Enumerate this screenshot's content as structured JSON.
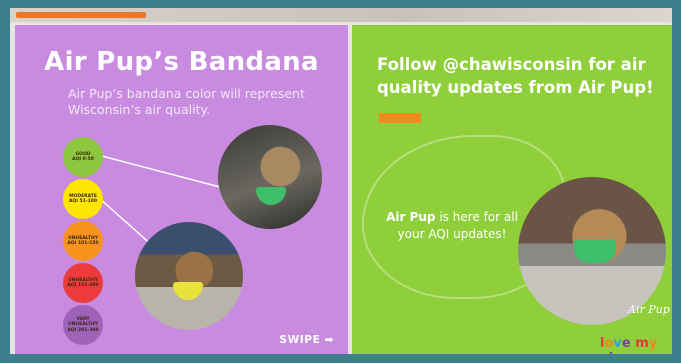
{
  "left": {
    "title": "Air Pup’s Bandana",
    "subtitle": "Air Pup’s bandana color will represent Wisconsin’s air quality.",
    "swipe": "SWIPE ➡",
    "levels": [
      {
        "line1": "GOOD",
        "line2": "AQI 0-50",
        "color": "#8dc63f"
      },
      {
        "line1": "MODERATE",
        "line2": "AQI 51-100",
        "color": "#ffe600"
      },
      {
        "line1": "UNHEALTHY",
        "line2": "AQI 101-150",
        "color": "#f7931e"
      },
      {
        "line1": "UNHEALTHY",
        "line2": "AQI 151-200",
        "color": "#ed3a3a"
      },
      {
        "line1": "VERY UNHEALTHY",
        "line2": "AQI 201-300",
        "color": "#9e62b8"
      }
    ]
  },
  "right": {
    "title": "Follow @chawisconsin for air quality updates from Air Pup!",
    "text_bold": "Air Pup",
    "text_rest": " is here for all your AQI updates!",
    "signature": "Air Pup",
    "logo": [
      "l",
      "o",
      "v",
      "e",
      " ",
      "m",
      "y",
      " ",
      "a",
      "i",
      "r"
    ]
  }
}
